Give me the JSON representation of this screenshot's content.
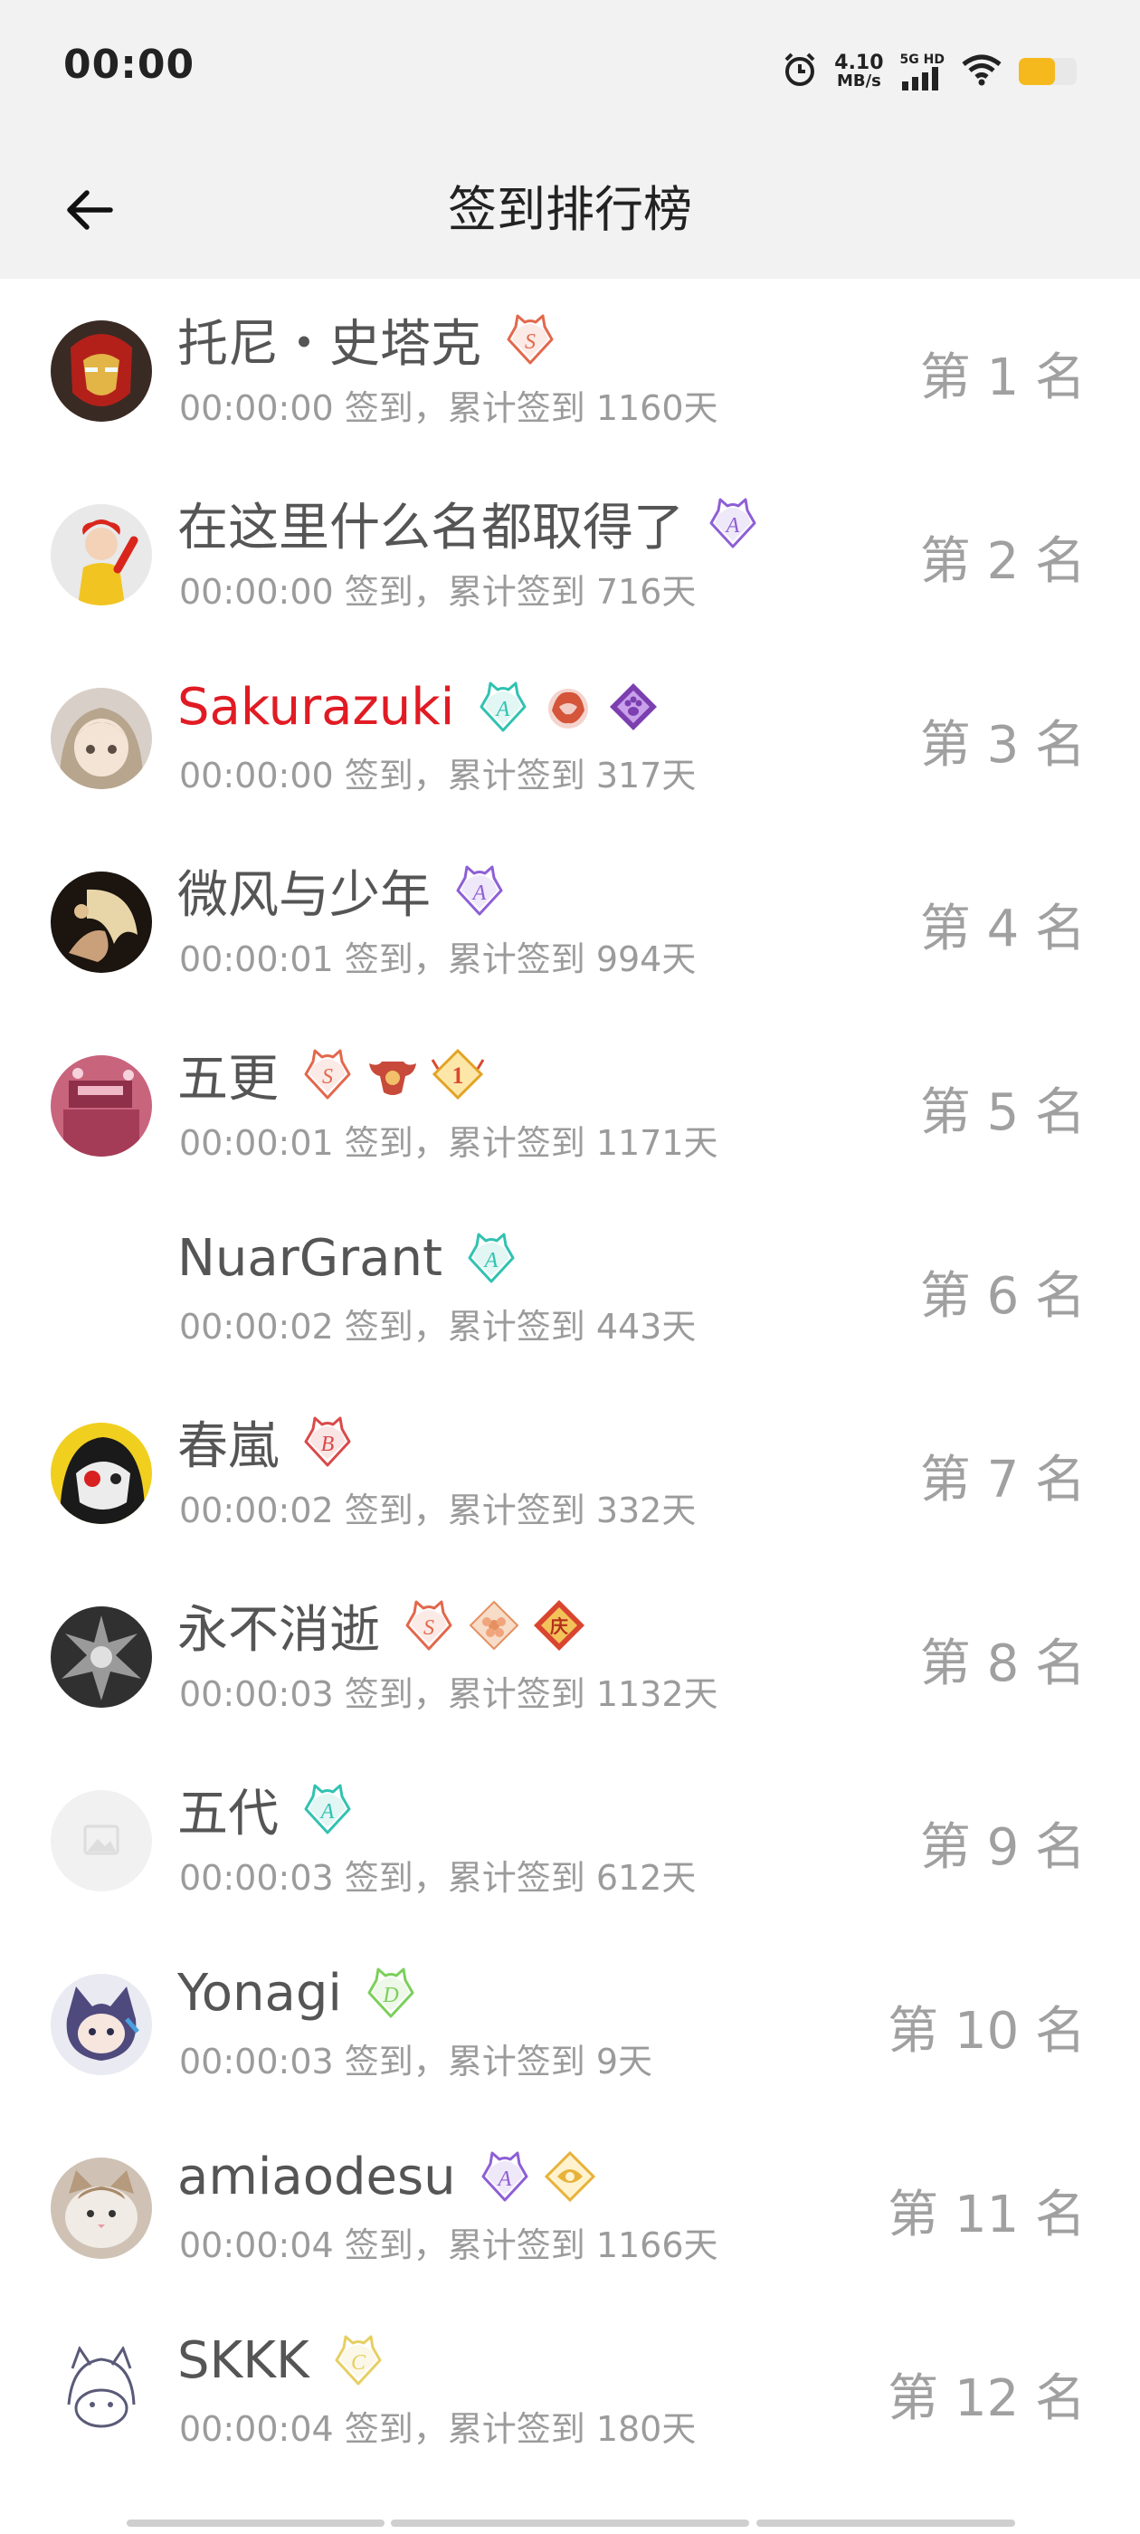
{
  "status_bar": {
    "time": "00:00",
    "speed_value": "4.10",
    "speed_unit": "MB/s",
    "network_label": "5G HD"
  },
  "header": {
    "title": "签到排行榜"
  },
  "colors": {
    "highlight_name": "#e01b24",
    "badge_purple": "#8e5fd6",
    "badge_teal": "#31c2b2",
    "badge_orange": "#e2684c",
    "badge_green": "#7ccf5a",
    "badge_yellow": "#e6cf63"
  },
  "rows": [
    {
      "name": "托尼・史塔克",
      "sub": "00:00:00 签到，累计签到 1160天",
      "rank": "第 1 名",
      "highlight": false,
      "avatar": "iron-man",
      "badges": [
        [
          "S",
          "#e2684c"
        ]
      ]
    },
    {
      "name": "在这里什么名都取得了",
      "sub": "00:00:00 签到，累计签到 716天",
      "rank": "第 2 名",
      "highlight": false,
      "avatar": "mcdonald",
      "badges": [
        [
          "A",
          "#8e5fd6"
        ]
      ]
    },
    {
      "name": "Sakurazuki",
      "sub": "00:00:00 签到，累计签到 317天",
      "rank": "第 3 名",
      "highlight": true,
      "avatar": "anime-girl",
      "badges": [
        [
          "A",
          "#31c2b2"
        ],
        [
          "dragon",
          "#d4553a"
        ],
        [
          "paw",
          "#7b3fb0"
        ]
      ]
    },
    {
      "name": "微风与少年",
      "sub": "00:00:01 签到，累计签到 994天",
      "rank": "第 4 名",
      "highlight": false,
      "avatar": "wind-boy",
      "badges": [
        [
          "A",
          "#8e5fd6"
        ]
      ]
    },
    {
      "name": "五更",
      "sub": "00:00:01 签到，累计签到 1171天",
      "rank": "第 5 名",
      "highlight": false,
      "avatar": "pink-street",
      "badges": [
        [
          "S",
          "#e2684c"
        ],
        [
          "bull",
          "#c74a3a"
        ],
        [
          "1",
          "#e3a326"
        ]
      ]
    },
    {
      "name": "NuarGrant",
      "sub": "00:00:02 签到，累计签到 443天",
      "rank": "第 6 名",
      "highlight": false,
      "avatar": "none",
      "badges": [
        [
          "A",
          "#31c2b2"
        ]
      ]
    },
    {
      "name": "春嵐",
      "sub": "00:00:02 签到，累计签到 332天",
      "rank": "第 7 名",
      "highlight": false,
      "avatar": "mask",
      "badges": [
        [
          "B",
          "#d94a4a"
        ]
      ]
    },
    {
      "name": "永不消逝",
      "sub": "00:00:03 签到，累计签到 1132天",
      "rank": "第 8 名",
      "highlight": false,
      "avatar": "dark-art",
      "badges": [
        [
          "S",
          "#e2684c"
        ],
        [
          "flower",
          "#e59060"
        ],
        [
          "庆",
          "#d9452e"
        ]
      ]
    },
    {
      "name": "五代",
      "sub": "00:00:03 签到，累计签到 612天",
      "rank": "第 9 名",
      "highlight": false,
      "avatar": "placeholder",
      "badges": [
        [
          "A",
          "#31c2b2"
        ]
      ]
    },
    {
      "name": "Yonagi",
      "sub": "00:00:03 签到，累计签到 9天",
      "rank": "第 10 名",
      "highlight": false,
      "avatar": "cat-girl",
      "badges": [
        [
          "D",
          "#7ccf5a"
        ]
      ]
    },
    {
      "name": "amiaodesu",
      "sub": "00:00:04 签到，累计签到 1166天",
      "rank": "第 11 名",
      "highlight": false,
      "avatar": "cat",
      "badges": [
        [
          "A",
          "#8e5fd6"
        ],
        [
          "gold",
          "#e8b23a"
        ]
      ]
    },
    {
      "name": "SKKK",
      "sub": "00:00:04 签到，累计签到 180天",
      "rank": "第 12 名",
      "highlight": false,
      "avatar": "sketch",
      "badges": [
        [
          "C",
          "#e6cf63"
        ]
      ]
    }
  ]
}
